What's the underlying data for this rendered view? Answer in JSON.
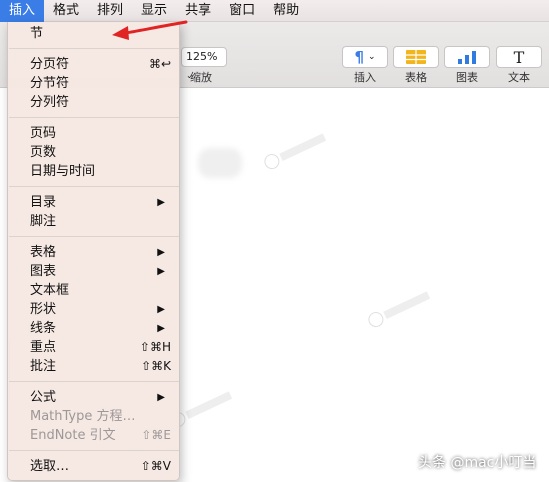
{
  "menubar": {
    "items": [
      "插入",
      "格式",
      "排列",
      "显示",
      "共享",
      "窗口",
      "帮助"
    ],
    "active_index": 0
  },
  "toolbar": {
    "zoom_value": "125%",
    "zoom_label": "缩放",
    "buttons": [
      {
        "label": "插入",
        "icon": "paragraph-icon"
      },
      {
        "label": "表格",
        "icon": "table-icon"
      },
      {
        "label": "图表",
        "icon": "bar-chart-icon"
      },
      {
        "label": "文本",
        "icon": "text-icon"
      }
    ]
  },
  "menu": {
    "items": [
      {
        "label": "节"
      },
      {
        "label": "分页符",
        "shortcut": "⌘↩"
      },
      {
        "label": "分节符"
      },
      {
        "label": "分列符"
      },
      {
        "label": "页码"
      },
      {
        "label": "页数"
      },
      {
        "label": "日期与时间"
      },
      {
        "label": "目录",
        "submenu": "▶"
      },
      {
        "label": "脚注"
      },
      {
        "label": "表格",
        "submenu": "▶"
      },
      {
        "label": "图表",
        "submenu": "▶"
      },
      {
        "label": "文本框"
      },
      {
        "label": "形状",
        "submenu": "▶"
      },
      {
        "label": "线条",
        "submenu": "▶"
      },
      {
        "label": "重点",
        "shortcut": "⇧⌘H"
      },
      {
        "label": "批注",
        "shortcut": "⇧⌘K"
      },
      {
        "label": "公式",
        "submenu": "▶"
      },
      {
        "label": "MathType 方程…",
        "disabled": true
      },
      {
        "label": "EndNote 引文",
        "shortcut": "⇧⌘E",
        "disabled": true
      },
      {
        "label": "选取…",
        "shortcut": "⇧⌘V"
      }
    ]
  },
  "watermark": "头条 @mac小叮当",
  "colors": {
    "accent": "#3b7de6",
    "annotation_arrow": "#e02424",
    "menu_bg": "#f6e8e2"
  }
}
